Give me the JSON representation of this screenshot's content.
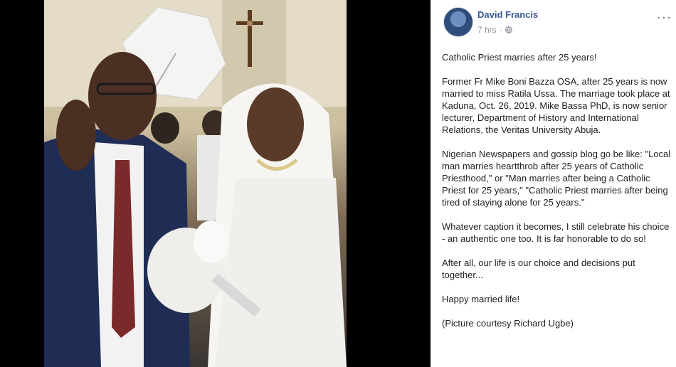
{
  "post": {
    "author": "David Francis",
    "time": "7 hrs",
    "separator": "·",
    "more": "···",
    "paragraphs": [
      "Catholic Priest marries after 25 years!",
      "Former Fr Mike Boni Bazza OSA, after 25 years is now married to miss Ratila Ussa. The marriage took place at Kaduna, Oct. 26, 2019. Mike Bassa PhD, is now senior lecturer, Department of History and International Relations, the Veritas University Abuja.",
      "Nigerian Newspapers and gossip blog go be like: \"Local man marries heartthrob after 25 years of Catholic Priesthood,\" or \"Man marries after being a Catholic Priest for 25 years,\" \"Catholic Priest marries after being tired of staying alone for 25 years.\"",
      "Whatever caption it becomes, I still celebrate his choice - an authentic one too. It is far honorable to do so!",
      "After all, our life is our choice and decisions put together...",
      "Happy married life!",
      "(Picture courtesy Richard Ugbe)"
    ]
  },
  "icons": {
    "avatar": "avatar-image",
    "privacy": "globe-icon",
    "menu": "more-options-icon"
  },
  "colors": {
    "author_link": "#385898",
    "meta_text": "#90949c",
    "body_text": "#1c1e21",
    "photo_backdrop": "#000000"
  }
}
